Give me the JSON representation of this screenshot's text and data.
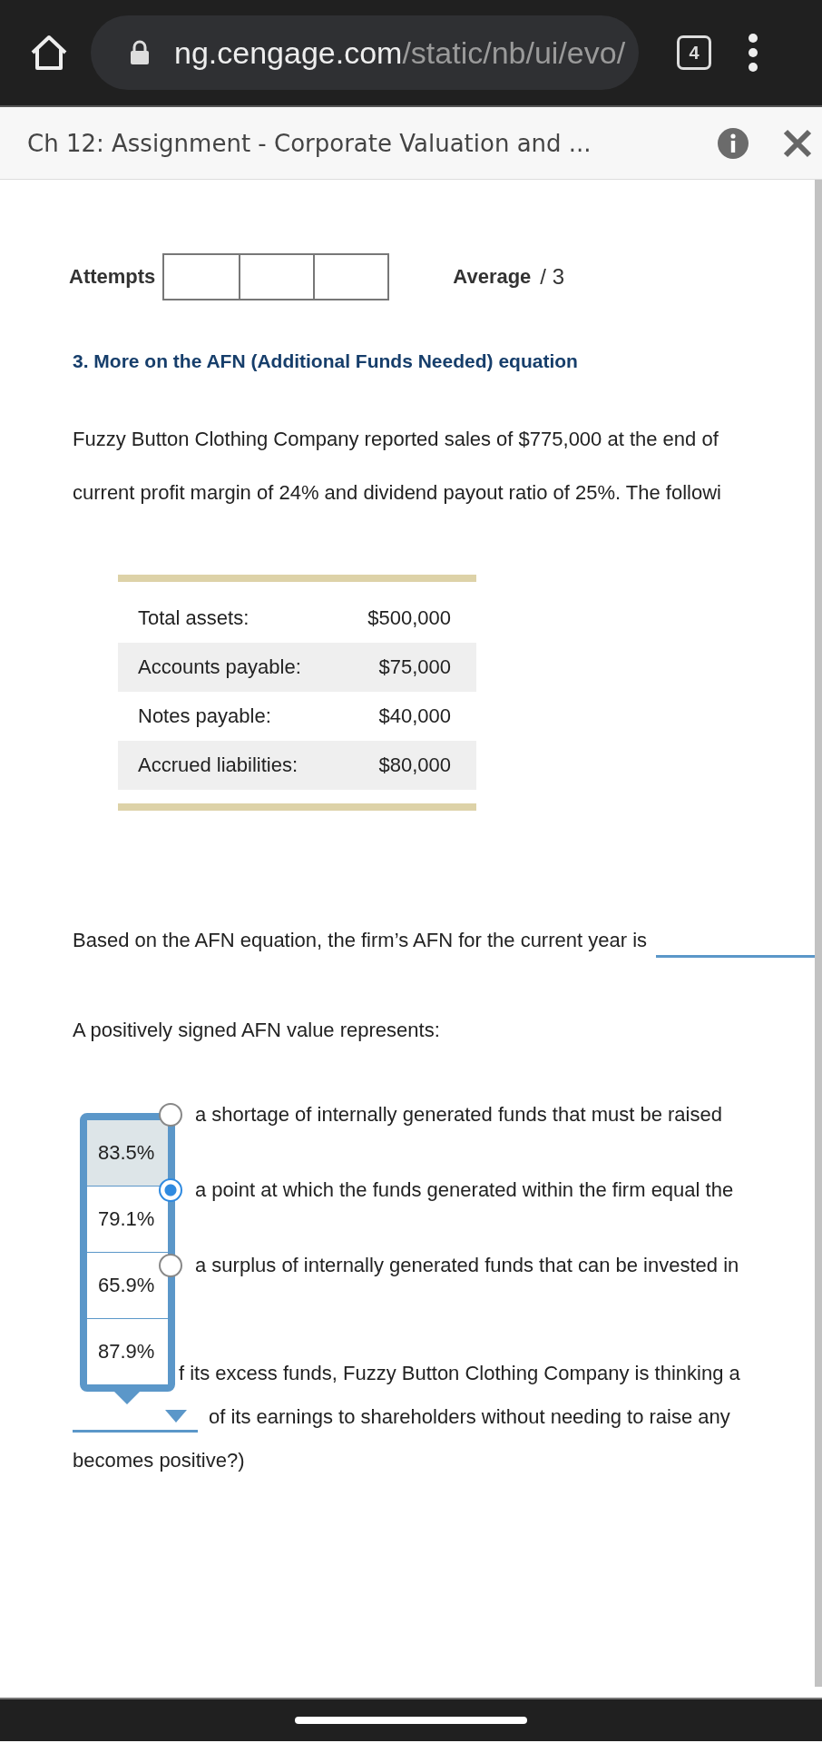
{
  "browser": {
    "url_host": "ng.cengage.com",
    "url_path": "/static/nb/ui/evo/",
    "tab_count": "4"
  },
  "header": {
    "title": "Ch 12: Assignment - Corporate Valuation and ..."
  },
  "attempts": {
    "label": "Attempts"
  },
  "average": {
    "label": "Average",
    "value": "/ 3"
  },
  "question": {
    "title": "3. More on the AFN (Additional Funds Needed) equation",
    "intro": [
      "Fuzzy Button Clothing Company reported sales of $775,000 at the end of",
      "current profit margin of 24% and dividend payout ratio of 25%. The followi"
    ]
  },
  "table": {
    "rows": [
      {
        "label": "Total assets:",
        "value": "$500,000"
      },
      {
        "label": "Accounts payable:",
        "value": "$75,000"
      },
      {
        "label": "Notes payable:",
        "value": "$40,000"
      },
      {
        "label": "Accrued liabilities:",
        "value": "$80,000"
      }
    ]
  },
  "afn_prompt": "Based on the AFN equation, the firm’s AFN for the current year is",
  "afn_question": "A positively signed AFN value represents:",
  "options": [
    {
      "text": "a shortage of internally generated funds that must be raised",
      "selected": false
    },
    {
      "text": "a point at which the funds generated within the firm equal the",
      "selected": true
    },
    {
      "text": "a surplus of internally generated funds that can be invested in",
      "selected": false
    }
  ],
  "payout": {
    "line1_rest": "f its excess funds, Fuzzy Button Clothing Company is thinking a",
    "line2": "of its earnings to shareholders without needing to raise any",
    "line3": "becomes positive?)",
    "dropdown": {
      "open": true,
      "options": [
        {
          "text": "83.5%",
          "highlighted": true
        },
        {
          "text": "79.1%",
          "highlighted": false
        },
        {
          "text": "65.9%",
          "highlighted": false
        },
        {
          "text": "87.9%",
          "highlighted": false
        }
      ]
    }
  }
}
